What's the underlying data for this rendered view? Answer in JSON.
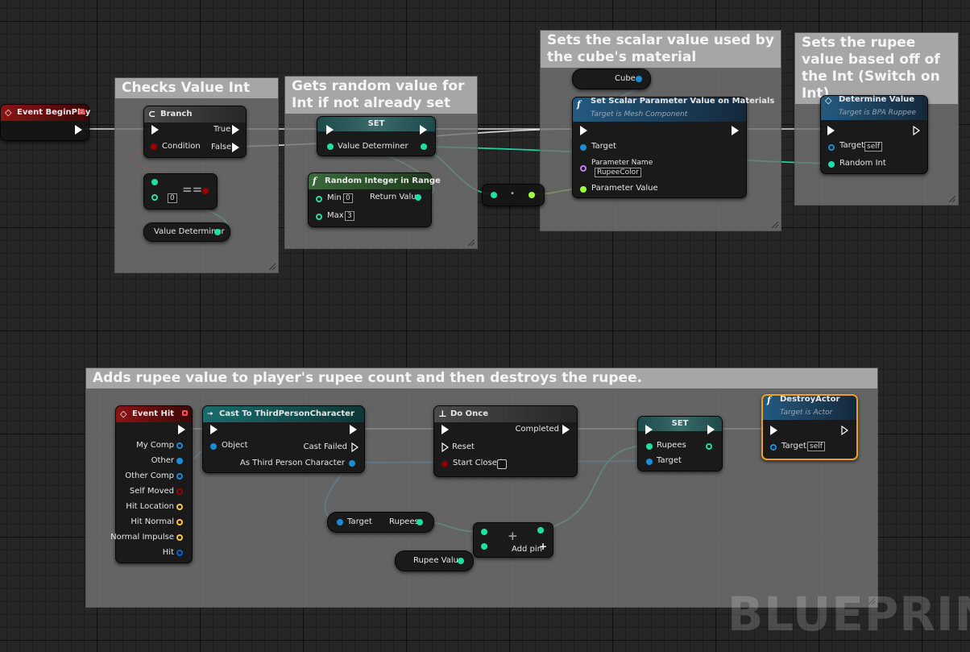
{
  "comments": {
    "checks": "Checks Value Int",
    "random": "Gets random value for Int if not already set",
    "scalar": "Sets the scalar value used by the cube's material",
    "rupee": "Sets the rupee value based off of the Int (Switch on Int)",
    "adds": "Adds rupee value to player's rupee count and then destroys the rupee."
  },
  "begin_play": {
    "title": "Event BeginPlay"
  },
  "branch": {
    "title": "Branch",
    "true": "True",
    "condition": "Condition",
    "false": "False"
  },
  "equals": {
    "symbol": "==",
    "value": "0"
  },
  "getter_value_determiner": "Value Determiner",
  "set_value": {
    "title": "SET",
    "pin": "Value Determiner"
  },
  "random_int": {
    "title": "Random Integer in Range",
    "min": "Min",
    "min_value": "0",
    "max": "Max",
    "max_value": "3",
    "return": "Return Value"
  },
  "reroute_dot": "•",
  "cube_getter": "Cube",
  "set_scalar": {
    "title": "Set Scalar Parameter Value on Materials",
    "subtitle": "Target is Mesh Component",
    "target": "Target",
    "param_name": "Parameter Name",
    "param_value_text": "RupeeColor",
    "param_value": "Parameter Value"
  },
  "determine": {
    "title": "Determine Value",
    "subtitle": "Target is BPA Ruppee",
    "target": "Target",
    "target_value": "self",
    "random_int": "Random Int"
  },
  "event_hit": {
    "title": "Event Hit",
    "pins": [
      "My Comp",
      "Other",
      "Other Comp",
      "Self Moved",
      "Hit Location",
      "Hit Normal",
      "Normal Impulse",
      "Hit"
    ]
  },
  "cast": {
    "title": "Cast To ThirdPersonCharacter",
    "object": "Object",
    "cast_failed": "Cast Failed",
    "as_char": "As Third Person Character"
  },
  "do_once": {
    "title": "Do Once",
    "completed": "Completed",
    "reset": "Reset",
    "start_closed": "Start Closed"
  },
  "set_rupees": {
    "title": "SET",
    "rupees": "Rupees",
    "target": "Target"
  },
  "destroy": {
    "title": "DestroyActor",
    "subtitle": "Target is Actor",
    "target": "Target",
    "target_value": "self"
  },
  "get_rupees": {
    "target": "Target",
    "rupees": "Rupees"
  },
  "add": {
    "symbol": "+",
    "add_pin": "Add pin"
  },
  "rupee_value": "Rupee Value",
  "watermark": "BLUEPRINT",
  "colors": {
    "exec": "#ffffff",
    "bool": "#8c0000",
    "int": "#1fe0a4",
    "float": "#a0ff3c",
    "object": "#00a8f4",
    "name": "#c77dff",
    "vector": "#ffc83c",
    "struct": "#0a64d0",
    "selected_border": "#f0a020"
  }
}
